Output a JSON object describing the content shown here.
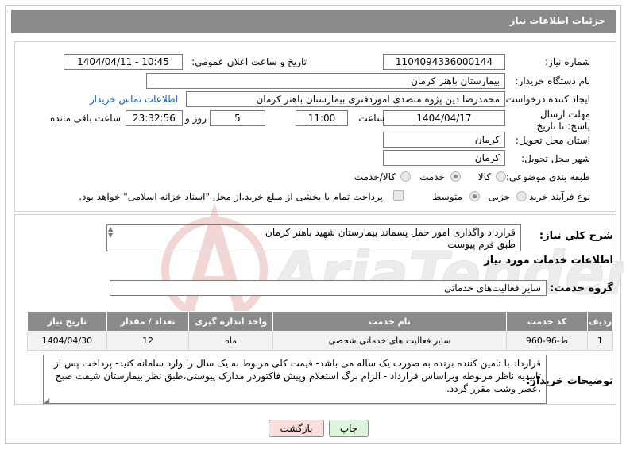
{
  "header": {
    "title": "جزئیات اطلاعات نیاز"
  },
  "fields": {
    "need_number_label": "شماره نیاز:",
    "need_number": "1104094336000144",
    "announce_label": "تاریخ و ساعت اعلان عمومی:",
    "announce_value": "1404/04/11 - 10:45",
    "buyer_org_label": "نام دستگاه خریدار:",
    "buyer_org": "بیمارستان باهنر کرمان",
    "creator_label": "ایجاد کننده درخواست:",
    "creator": "محمدرضا  دین پژوه متصدی اموردفتری بیمارستان باهنر کرمان",
    "contact_link": "اطلاعات تماس خریدار",
    "deadline_label": "مهلت ارسال پاسخ: تا تاریخ:",
    "deadline_date": "1404/04/17",
    "hour_label": "ساعت",
    "deadline_hour": "11:00",
    "days_value": "5",
    "days_label": "روز و",
    "remaining_time": "23:32:56",
    "remaining_label": "ساعت باقی مانده",
    "province_label": "استان محل تحویل:",
    "province": "کرمان",
    "city_label": "شهر محل تحویل:",
    "city": "کرمان",
    "category_label": "طبقه بندی موضوعی:",
    "category_options": [
      "کالا",
      "خدمت",
      "کالا/خدمت"
    ],
    "process_label": "نوع فرآیند خرید :",
    "process_options": [
      "جزیی",
      "متوسط"
    ],
    "payment_note": "پرداخت تمام یا بخشی از مبلغ خرید،از محل \"اسناد خزانه اسلامی\" خواهد بود."
  },
  "description": {
    "label": "شرح کلي نياز:",
    "text_line1": "قرارداد  واگذاری امور حمل پسماند بیمارستان شهید باهنر کرمان",
    "text_line2": "طبق فرم پیوست"
  },
  "services": {
    "section_title": "اطلاعات خدمات مورد نیاز",
    "group_label": "گروه خدمت:",
    "group_value": "سایر فعالیت‌های خدماتی",
    "columns": [
      "ردیف",
      "کد خدمت",
      "نام خدمت",
      "واحد اندازه گیری",
      "تعداد / مقدار",
      "تاریخ نیاز"
    ],
    "rows": [
      [
        "1",
        "ط-96-960",
        "سایر فعالیت های خدماتی شخصی",
        "ماه",
        "12",
        "1404/04/30"
      ]
    ]
  },
  "buyer_notes": {
    "label": "توضیحات خریدار:",
    "line1": "قرارداد با تامین کننده برنده به صورت یک ساله می باشد- قیمت کلی مربوط به یک سال را وارد سامانه کنید- پرداخت پس از",
    "line2": "تاییدیه ناظر مربوطه وبراساس قرارداد -  الزام برگ استعلام وپیش فاکتوردر مدارک پیوستی،طبق نظر بیمارستان شیفت صبح",
    "line3": "،عصر وشب مقرر گردد."
  },
  "buttons": {
    "print": "چاپ",
    "back": "بازگشت"
  },
  "watermark_text": "AriaTender.neT",
  "colors": {
    "header_bg": "#8a8a8a",
    "link": "#1a5fb4",
    "watermark": "#e8b4b4",
    "back_button": "#f9dede",
    "print_button": "#dcf5dc"
  }
}
